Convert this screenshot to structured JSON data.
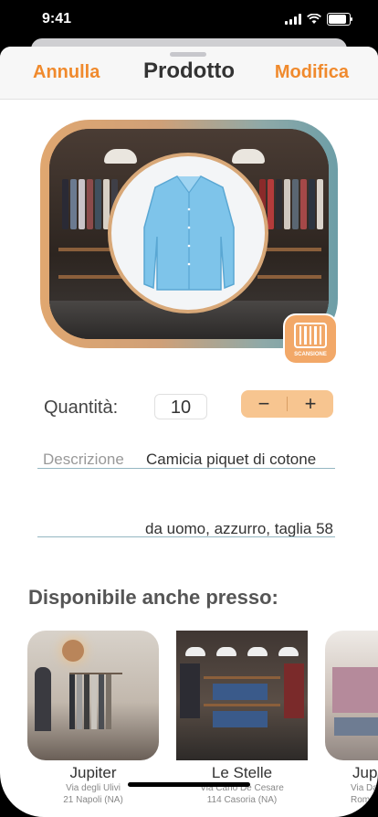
{
  "status": {
    "time": "9:41"
  },
  "nav": {
    "cancel": "Annulla",
    "title": "Prodotto",
    "edit": "Modifica"
  },
  "scan": {
    "label": "SCANSIONE"
  },
  "quantity": {
    "label": "Quantità:",
    "value": "10",
    "minus": "−",
    "plus": "+"
  },
  "description": {
    "label": "Descrizione",
    "line1": "Camicia piquet di cotone",
    "line2": "da uomo, azzurro, taglia 58"
  },
  "availability": {
    "title": "Disponibile anche presso:",
    "stores": [
      {
        "name": "Jupiter",
        "addr1": "Via degli Ulivi",
        "addr2": "21 Napoli (NA)"
      },
      {
        "name": "Le Stelle",
        "addr1": "Via Carlo De Cesare",
        "addr2": "114 Casoria (NA)"
      },
      {
        "name": "Jup",
        "addr1": "Via Da",
        "addr2": "Roma"
      }
    ]
  },
  "colors": {
    "accent": "#f08a2d",
    "stepper": "#f7c590",
    "underline": "#94b7c2"
  }
}
